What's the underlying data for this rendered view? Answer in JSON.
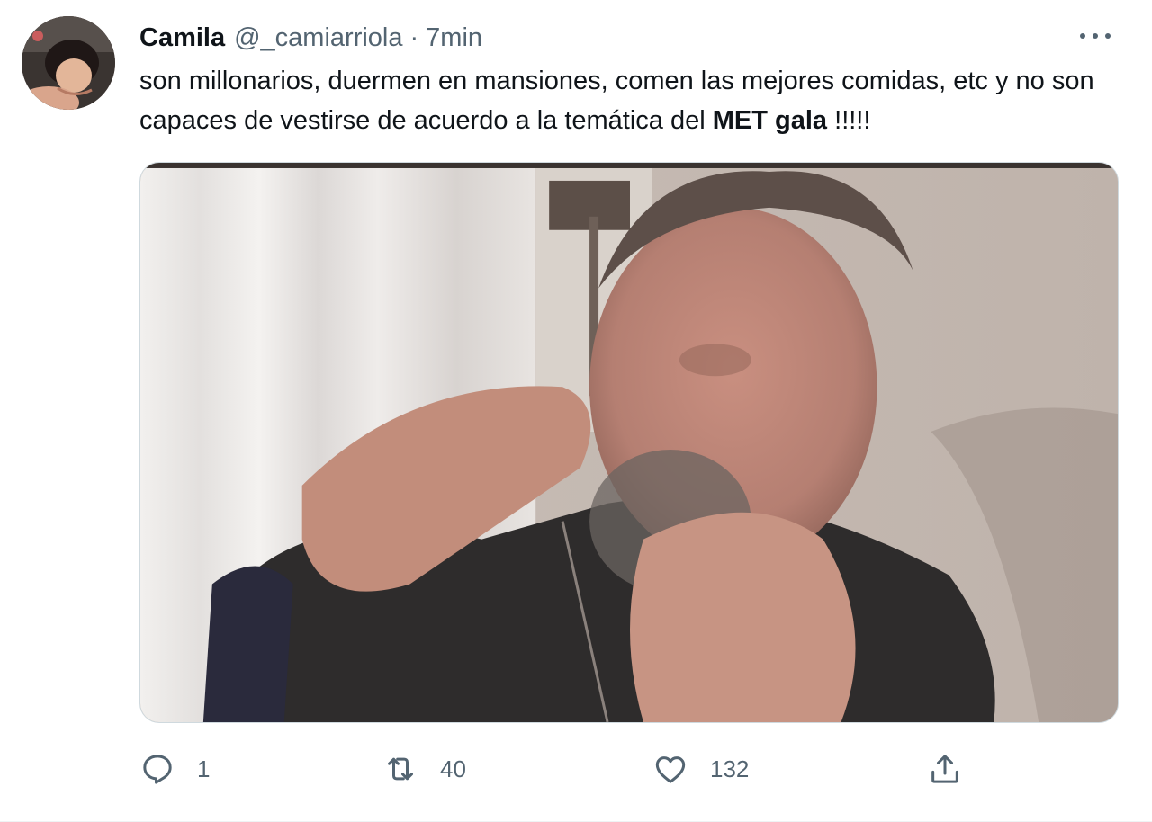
{
  "tweet": {
    "author": {
      "display_name": "Camila",
      "handle": "@_camiarriola"
    },
    "separator": "·",
    "time": "7min",
    "text": {
      "before_bold": "son millonarios, duermen en mansiones, comen las mejores comidas, etc y no son capaces de vestirse de acuerdo a la temática del ",
      "bold": "MET gala",
      "after_bold": " !!!!!"
    },
    "actions": {
      "replies": "1",
      "retweets": "40",
      "likes": "132"
    }
  },
  "icons": {
    "more": "more-horizontal-icon",
    "reply": "reply-icon",
    "retweet": "retweet-icon",
    "like": "heart-icon",
    "share": "share-icon"
  },
  "colors": {
    "text_primary": "#0f1419",
    "text_secondary": "#536471",
    "border": "#cfd9de"
  }
}
